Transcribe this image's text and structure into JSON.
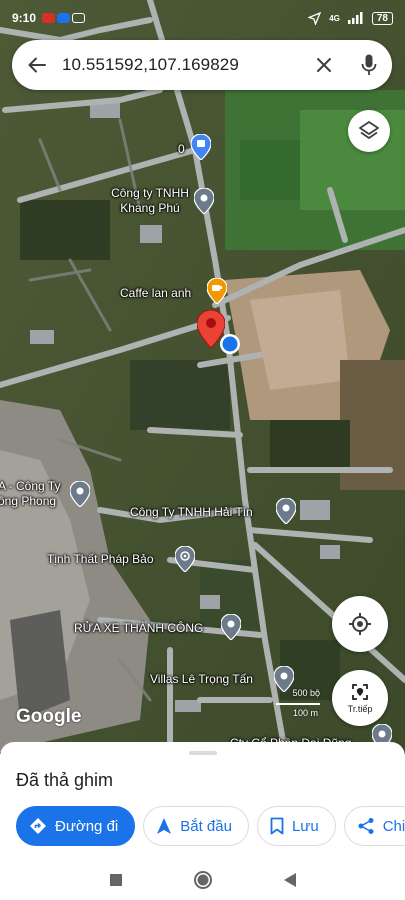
{
  "status_bar": {
    "time": "9:10",
    "network": "4G",
    "battery": "78"
  },
  "search": {
    "query": "10.551592,107.169829",
    "back_icon": "arrow-back-icon",
    "clear_icon": "close-icon",
    "mic_icon": "mic-icon"
  },
  "map": {
    "places": [
      {
        "label": "0",
        "icon": "shopping-bag-pin-icon"
      },
      {
        "label": "Công ty TNHH\nKhang Phú",
        "icon": "place-pin-icon"
      },
      {
        "label": "Caffe lan anh",
        "icon": "cafe-pin-icon"
      },
      {
        "label": "A - Công Ty\nông Phong",
        "icon": "place-pin-icon"
      },
      {
        "label": "Công Ty TNHH Hải Tín",
        "icon": "place-pin-icon"
      },
      {
        "label": "Tịnh Thất Pháp Bảo",
        "icon": "temple-pin-icon"
      },
      {
        "label": "RỬA XE THÀNH CÔNG",
        "icon": "place-pin-icon"
      },
      {
        "label": "Villas Lê Trọng Tấn",
        "icon": "place-pin-icon"
      },
      {
        "label": "Cty Cổ Phần Đại Dũng",
        "icon": "place-pin-icon"
      }
    ],
    "dropped_pin_icon": "red-pin-icon",
    "current_location_icon": "blue-dot-icon",
    "layers_icon": "layers-icon",
    "my_location_icon": "my-location-icon",
    "navigate_label": "Tr.tiếp",
    "google_logo": "Google",
    "scale": {
      "top": "500 bộ",
      "bottom": "100 m"
    }
  },
  "sheet": {
    "title": "Đã thả ghim",
    "chips": [
      {
        "label": "Đường đi",
        "icon": "directions-icon"
      },
      {
        "label": "Bắt đầu",
        "icon": "navigation-arrow-icon"
      },
      {
        "label": "Lưu",
        "icon": "bookmark-icon"
      },
      {
        "label": "Chi",
        "icon": "share-icon"
      }
    ]
  },
  "colors": {
    "accent": "#1a73e8",
    "pin_red": "#ea4335",
    "pin_gray": "#6b7b8c",
    "pin_orange": "#f29900"
  }
}
